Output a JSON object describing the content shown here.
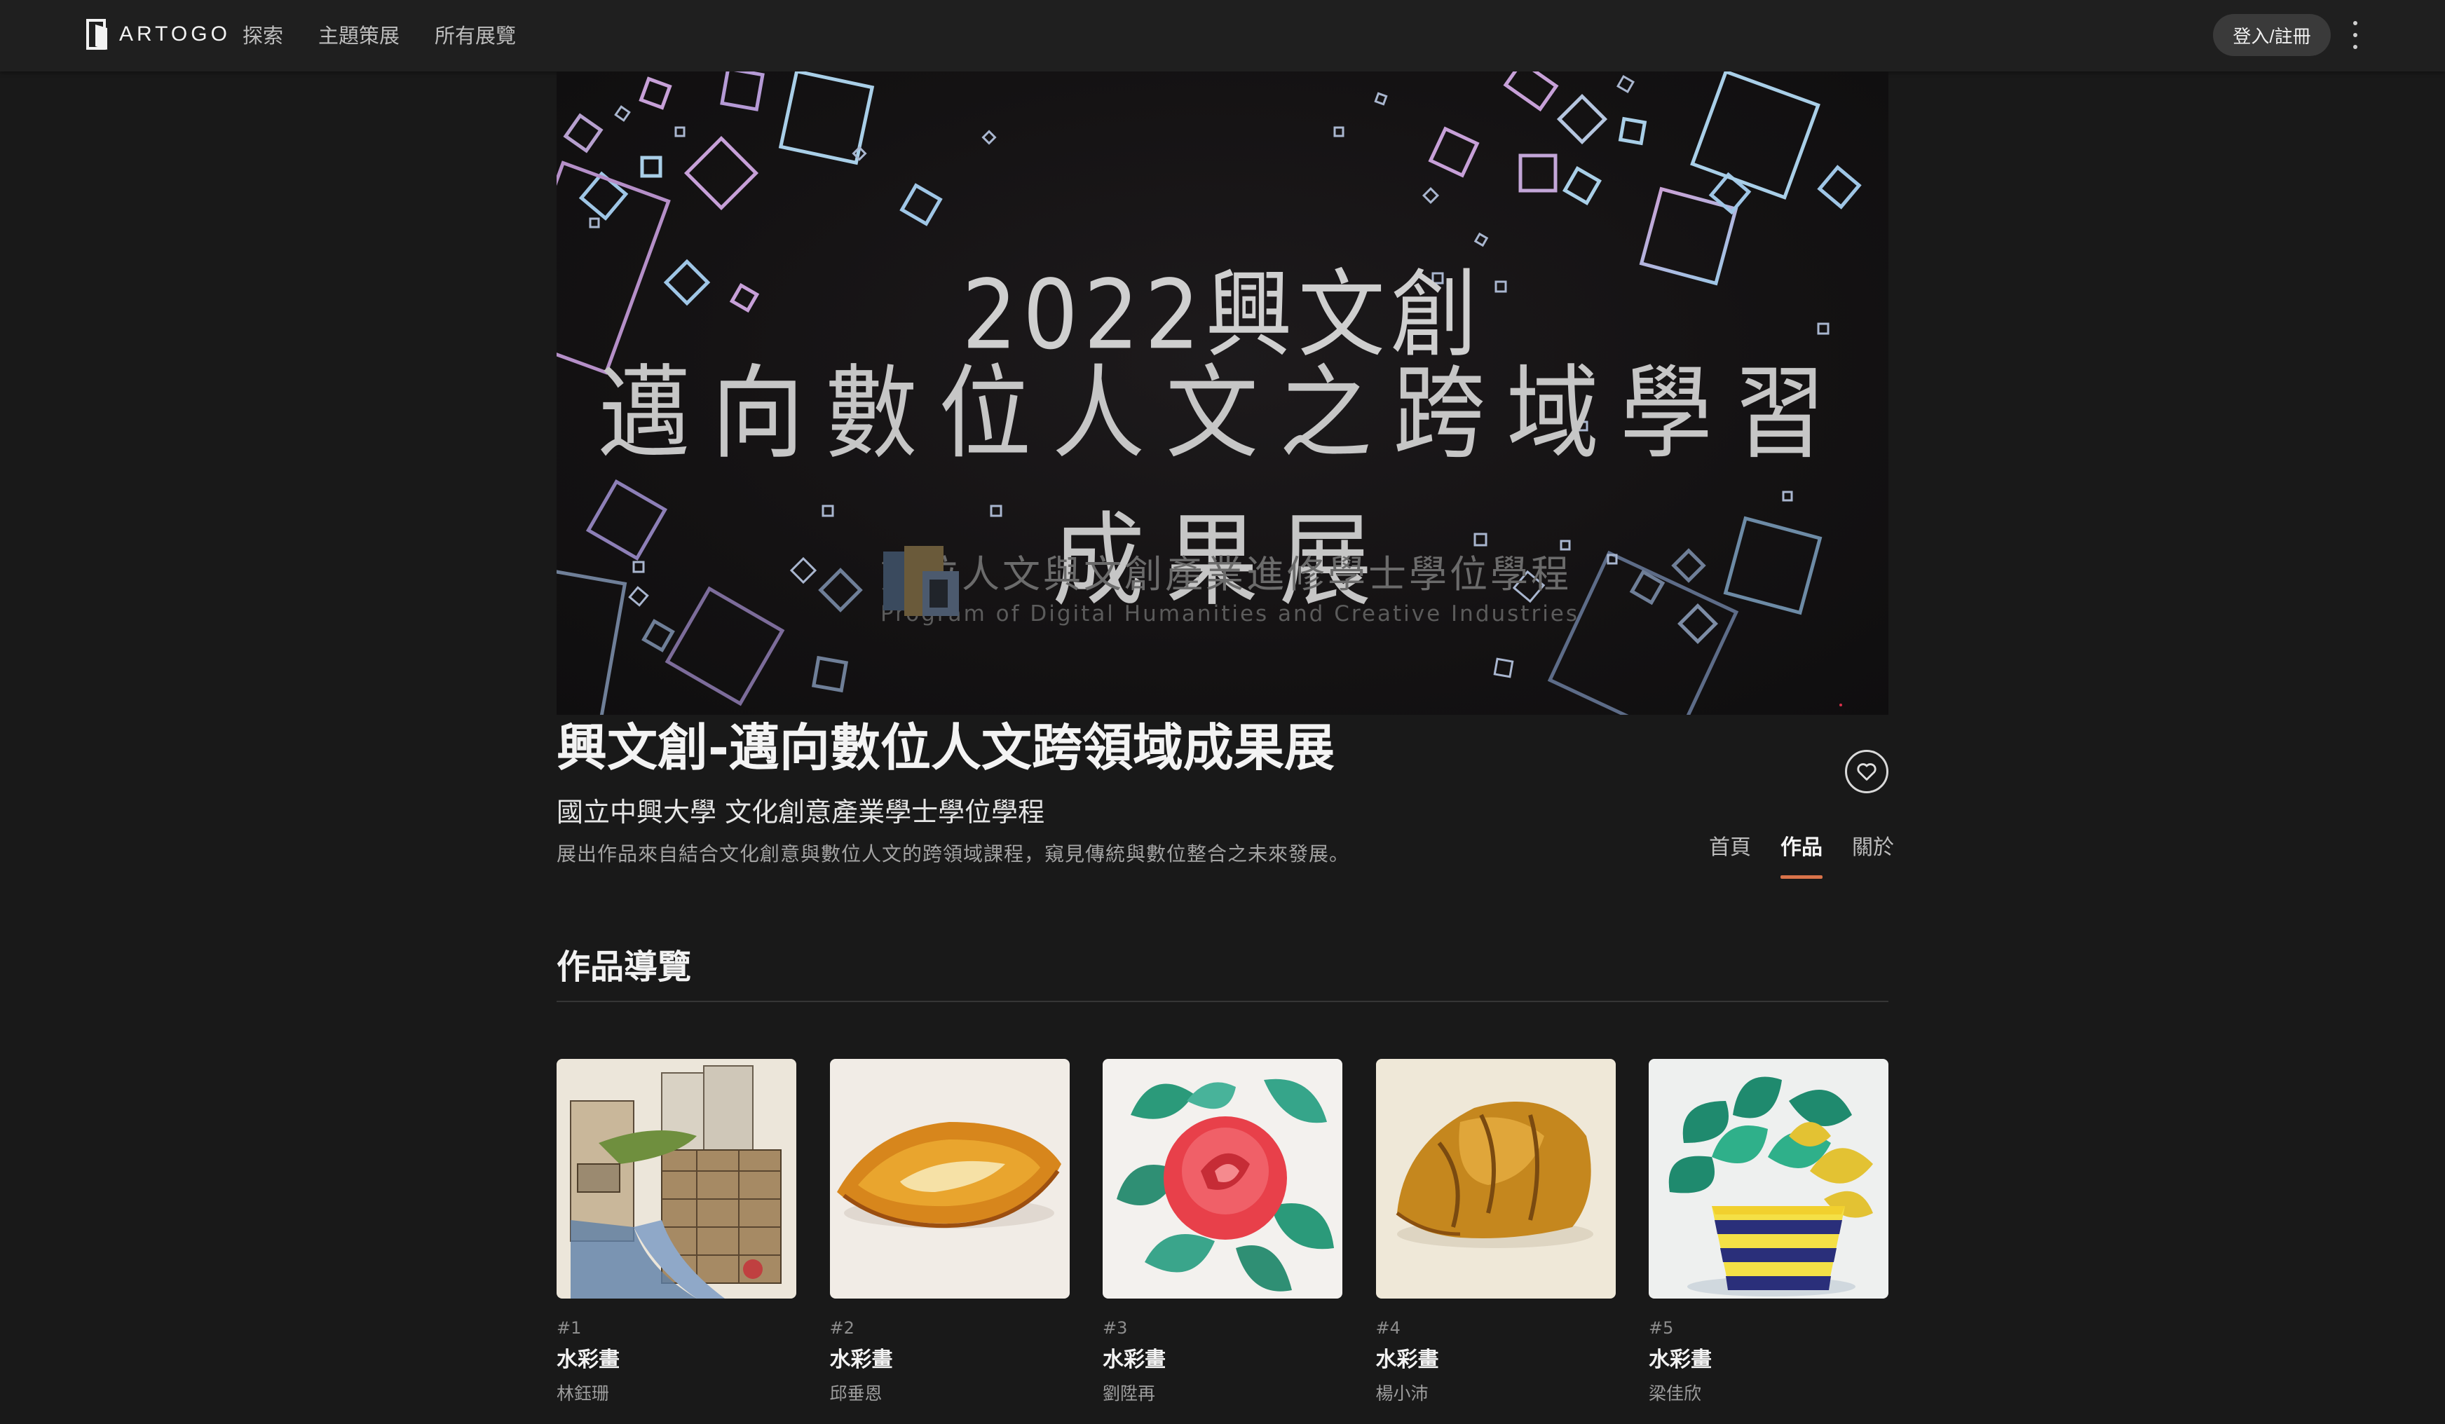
{
  "brand": {
    "name": "ARTOGO"
  },
  "nav": {
    "items": [
      "探索",
      "主題策展",
      "所有展覽"
    ]
  },
  "header": {
    "login_label": "登入/註冊"
  },
  "banner": {
    "title_line1": "2022興文創",
    "title_line2": "邁向數位人文之跨域學習成果展",
    "org_zh": "數位人文與文創產業進修學士學位學程",
    "org_en": "Program of Digital Humanities and Creative Industries"
  },
  "exhibition": {
    "title": "興文創-邁向數位人文跨領域成果展",
    "organizer": "國立中興大學 文化創意產業學士學位學程",
    "description": "展出作品來自結合文化創意與數位人文的跨領域課程，窺見傳統與數位整合之未來發展。"
  },
  "tabs": [
    {
      "label": "首頁",
      "active": false
    },
    {
      "label": "作品",
      "active": true
    },
    {
      "label": "關於",
      "active": false
    }
  ],
  "works_section": {
    "title": "作品導覽",
    "works": [
      {
        "number": "#1",
        "title": "水彩畫",
        "artist": "林鈺珊"
      },
      {
        "number": "#2",
        "title": "水彩畫",
        "artist": "邱垂恩"
      },
      {
        "number": "#3",
        "title": "水彩畫",
        "artist": "劉陞再"
      },
      {
        "number": "#4",
        "title": "水彩畫",
        "artist": "楊小沛"
      },
      {
        "number": "#5",
        "title": "水彩畫",
        "artist": "梁佳欣"
      }
    ]
  },
  "colors": {
    "background": "#191919",
    "topbar": "#1f1f1f",
    "accent": "#d9734a"
  },
  "icons": {
    "logo": "artogo-logo-icon",
    "more": "more-vertical-icon",
    "favorite": "heart-icon"
  }
}
